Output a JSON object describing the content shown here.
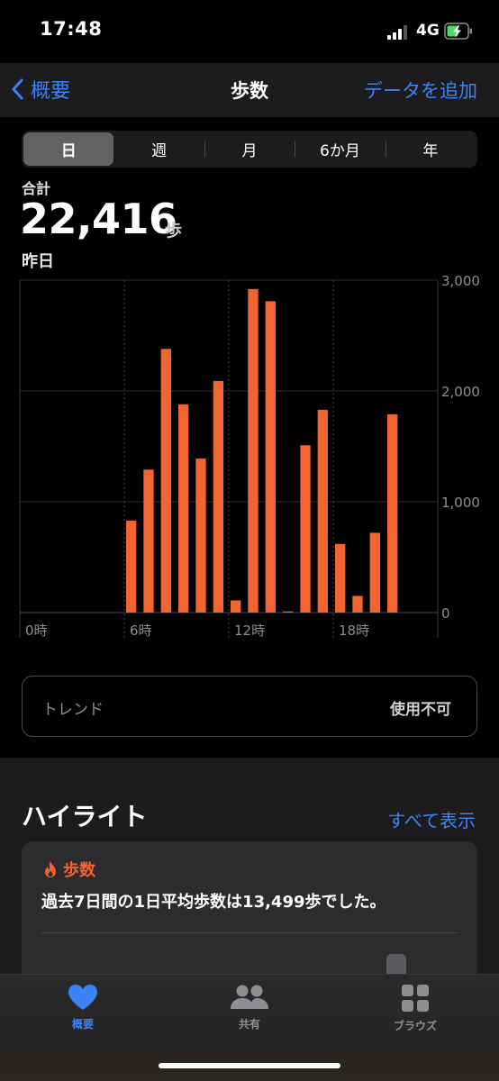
{
  "status_bar": {
    "time": "17:48",
    "network": "4G"
  },
  "nav": {
    "back_label": "概要",
    "title": "歩数",
    "add_label": "データを追加"
  },
  "segments": [
    "日",
    "週",
    "月",
    "6か月",
    "年"
  ],
  "selected_segment": "日",
  "summary": {
    "total_label": "合計",
    "total_value": "22,416",
    "unit": "歩",
    "date_label": "昨日"
  },
  "chart_data": {
    "type": "bar",
    "x_unit": "hour",
    "categories": [
      0,
      1,
      2,
      3,
      4,
      5,
      6,
      7,
      8,
      9,
      10,
      11,
      12,
      13,
      14,
      15,
      16,
      17,
      18,
      19,
      20,
      21,
      22,
      23
    ],
    "values": [
      0,
      0,
      0,
      0,
      0,
      0,
      830,
      1290,
      2380,
      1880,
      1390,
      2090,
      110,
      2920,
      2810,
      10,
      1510,
      1830,
      620,
      150,
      720,
      1790,
      0,
      0
    ],
    "x_tick_labels": [
      "0時",
      "6時",
      "12時",
      "18時"
    ],
    "x_tick_positions": [
      0,
      6,
      12,
      18
    ],
    "y_tick_labels": [
      "3,000",
      "2,000",
      "1,000",
      "0"
    ],
    "ylim": [
      0,
      3000
    ],
    "bar_color": "#f26430",
    "grid": true
  },
  "trend": {
    "label": "トレンド",
    "status": "使用不可"
  },
  "highlights": {
    "title": "ハイライト",
    "show_all": "すべて表示",
    "card": {
      "category": "歩数",
      "text": "過去7日間の1日平均歩数は13,499歩でした。"
    }
  },
  "tabs": [
    {
      "label": "概要",
      "icon": "heart-icon",
      "active": true
    },
    {
      "label": "共有",
      "icon": "people-icon",
      "active": false
    },
    {
      "label": "ブラウズ",
      "icon": "grid-icon",
      "active": false
    }
  ],
  "colors": {
    "accent": "#3b82f6",
    "steps": "#f26430",
    "inactive_tab": "#8e8e93"
  }
}
